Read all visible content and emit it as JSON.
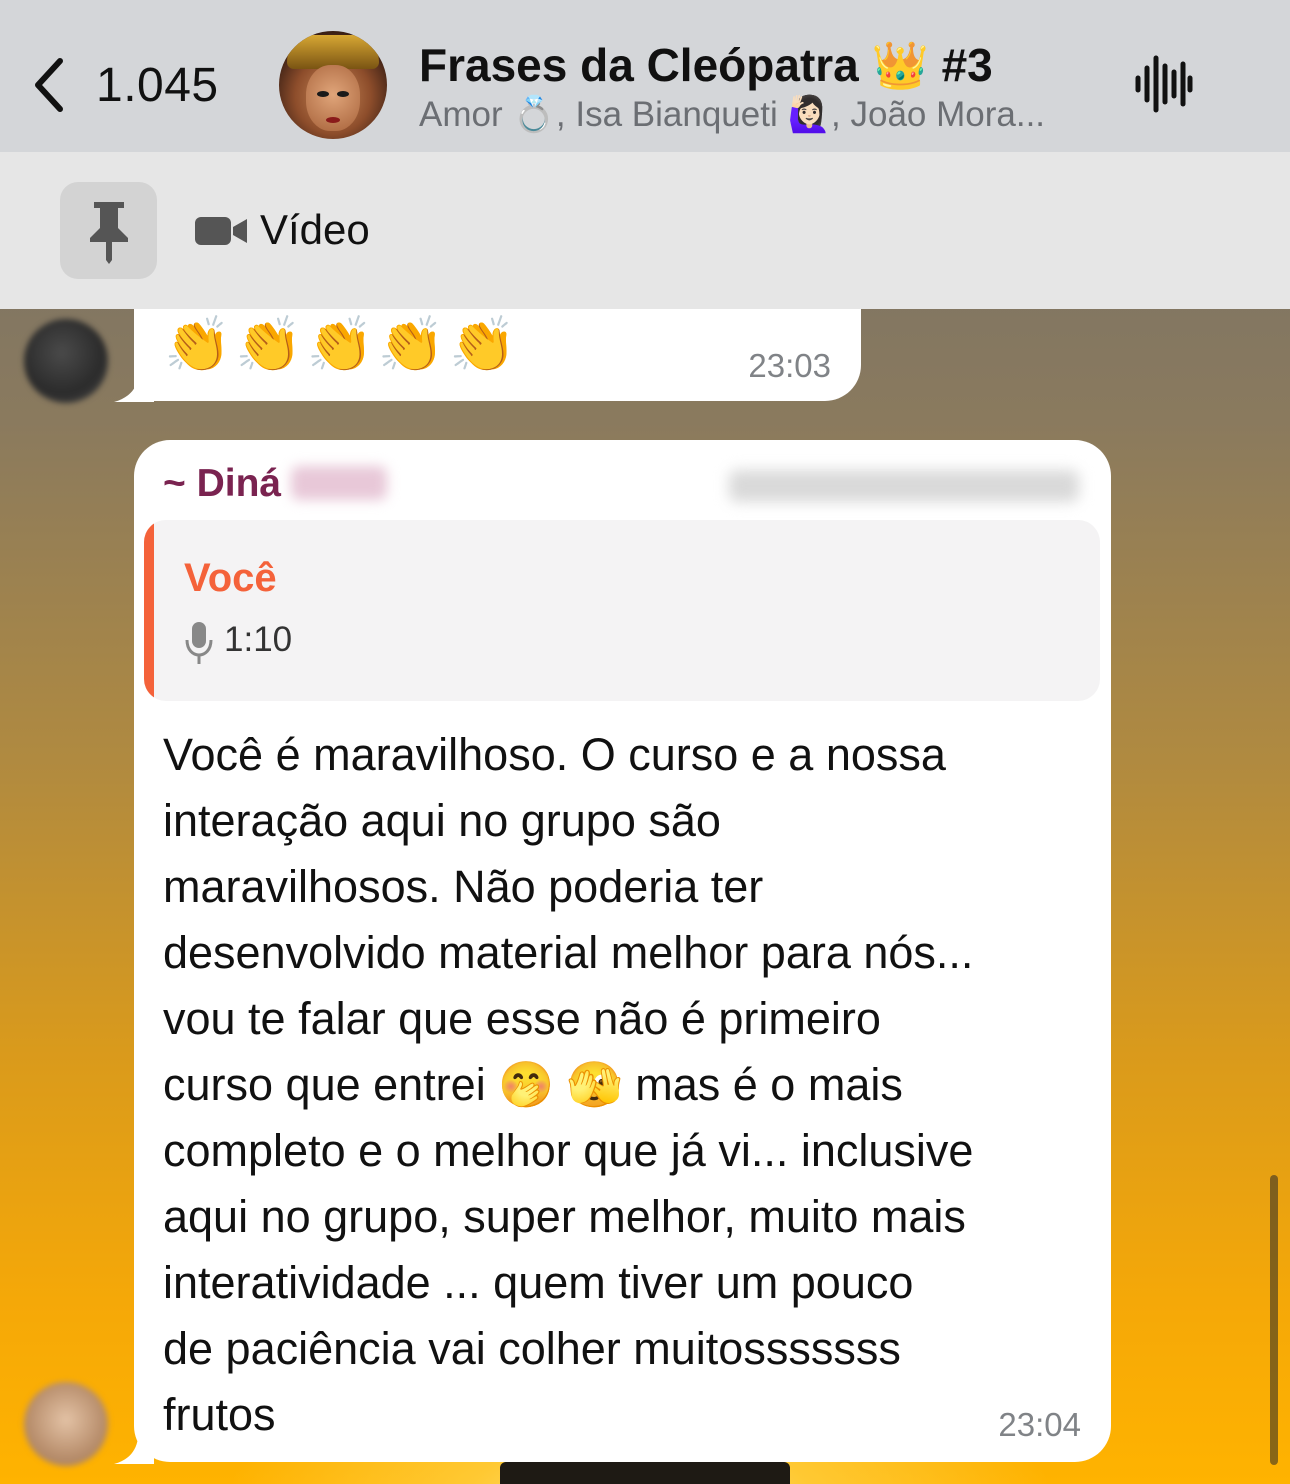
{
  "header": {
    "back_count": "1.045",
    "title": "Frases da Cleópatra 👑 #3",
    "members": "Amor 💍, Isa Bianqueti 🙋🏻‍♀️, João Mora...",
    "back_icon": "chevron-left-icon",
    "voice_icon": "waveform-icon"
  },
  "pinned": {
    "icon": "pin-icon",
    "media_icon": "video-camera-icon",
    "label": "Vídeo"
  },
  "messages": [
    {
      "content": "👏👏👏👏👏",
      "time": "23:03"
    },
    {
      "sender": "~ Diná",
      "quote": {
        "author": "Você",
        "duration": "1:10",
        "icon": "microphone-icon"
      },
      "text": "Você é maravilhoso. O curso e a nossa\ninteração aqui no grupo são\nmaravilhosos. Não poderia ter\ndesenvolvido material melhor para nós...\nvou te falar que esse não é primeiro\ncurso que entrei 🤭 🫣  mas é o mais\ncompleto e o melhor que já vi... inclusive\naqui no grupo, super melhor, muito mais\ninteratividade  ... quem tiver um pouco\nde paciência vai colher muitosssssss\nfrutos",
      "time": "23:04"
    }
  ],
  "colors": {
    "sender_name": "#7a2350",
    "quote_accent": "#f4623a",
    "header_bg": "#d4d6d9",
    "pinned_bg": "#e6e6e6"
  }
}
